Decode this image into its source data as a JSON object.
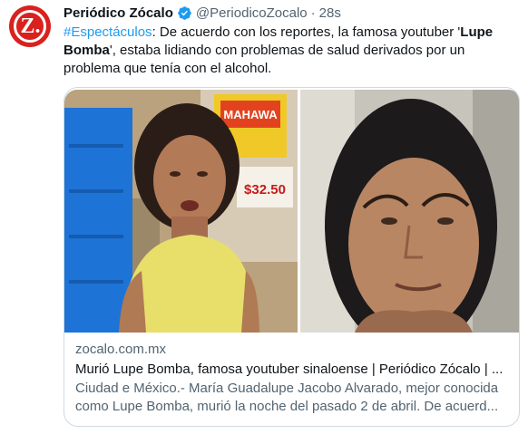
{
  "account": {
    "name": "Periódico Zócalo",
    "handle": "@PeriodicoZocalo",
    "separator": "·",
    "time": "28s",
    "avatar_letter": "Z.",
    "verified_color": "#1d9bf0",
    "brand_color": "#d9211e"
  },
  "tweet": {
    "hashtag": "#Espectáculos",
    "text_part1": ": De acuerdo con los reportes, la famosa youtuber '",
    "bold_name": "Lupe Bomba",
    "text_part2": "', estaba lidiando con problemas de salud derivados por un problema que tenía con el alcohol."
  },
  "media_sign": {
    "brand": "MAHAWA",
    "price": "$32.50"
  },
  "link_card": {
    "domain": "zocalo.com.mx",
    "title": "Murió Lupe Bomba, famosa youtuber sinaloense | Periódico Zócalo | ...",
    "description": "Ciudad e México.- María Guadalupe Jacobo Alvarado, mejor conocida como Lupe Bomba, murió la noche del pasado 2 de abril. De acuerd..."
  }
}
